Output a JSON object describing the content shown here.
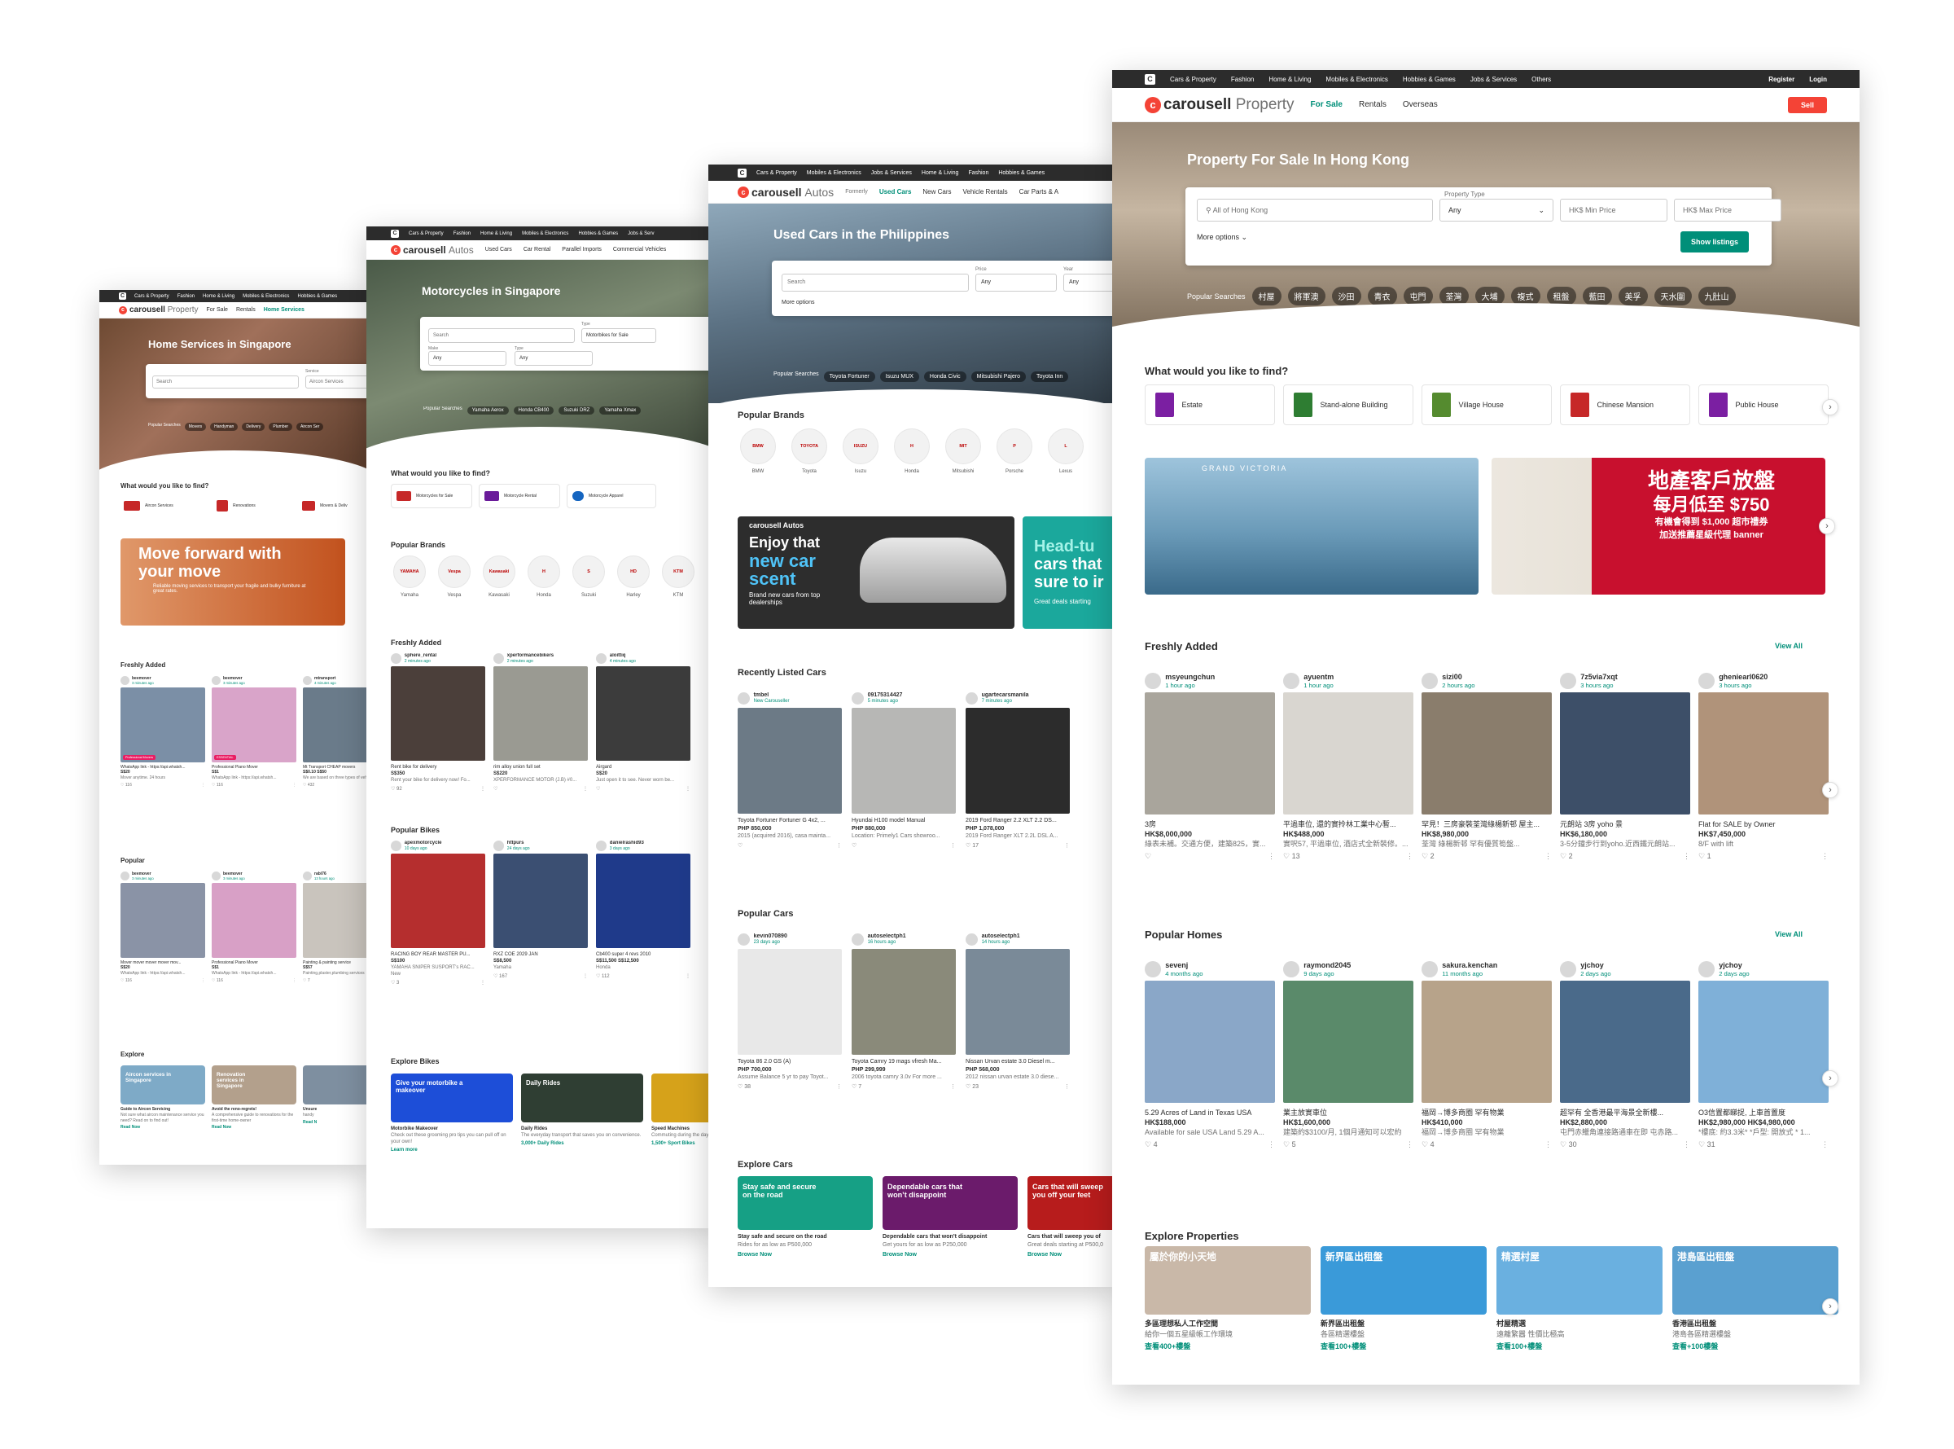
{
  "page1": {
    "topnav": [
      "Cars & Property",
      "Fashion",
      "Home & Living",
      "Mobiles & Electronics",
      "Hobbies & Games"
    ],
    "brand": "carousell",
    "brand_sub": "Property",
    "tabs": [
      "For Sale",
      "Rentals",
      "Home Services"
    ],
    "hero_title": "Home Services in Singapore",
    "search_placeholder": "Search",
    "service_label": "Service",
    "service_value": "Aircon Services",
    "popular_label": "Popular Searches",
    "popular": [
      "Movers",
      "Handyman",
      "Delivery",
      "Plumber",
      "Aircon Ser"
    ],
    "find_title": "What would you like to find?",
    "categories": [
      "Aircon Services",
      "Renovations",
      "Movers & Deliv"
    ],
    "banner_title": "Move forward with your move",
    "banner_sub": "Reliable moving services to transport your fragile and bulky furniture at great rates.",
    "fresh_title": "Freshly Added",
    "fresh": [
      {
        "user": "beemover",
        "time": "3 minutes ago",
        "badge": "Professional Movers",
        "price": "S$20",
        "desc": "WhatsApp link - https://api.whatsh...",
        "sub": "Mover anytime. 24 hours",
        "likes": "116"
      },
      {
        "user": "beemover",
        "time": "3 minutes ago",
        "badge": "ESSENTIAL",
        "price": "S$1",
        "desc": "Professional Piano Mover",
        "sub": "WhatsApp link - https://api.whatsh...",
        "likes": "116"
      },
      {
        "user": "mtransport",
        "time": "4 minutes ago",
        "badge": "",
        "price": "S$0.10 S$50",
        "desc": "Mt Transport CHEAP movers",
        "sub": "We are based on three types of vehicles",
        "likes": "432"
      }
    ],
    "popular_title": "Popular",
    "popular_items": [
      {
        "user": "beemover",
        "time": "3 minutes ago",
        "price": "S$20",
        "desc": "Mover mover mover mover mov...",
        "sub": "WhatsApp link - https://api.whatsh...",
        "likes": "116"
      },
      {
        "user": "beemover",
        "time": "3 minutes ago",
        "price": "S$1",
        "desc": "Professional Piano Mover",
        "sub": "WhatsApp link - https://api.whatsh...",
        "likes": "116"
      },
      {
        "user": "rabi76",
        "time": "13 hours ago",
        "price": "S$57",
        "desc": "Painting & painting service",
        "sub": "Painting,plaster,plumbing services",
        "likes": "7"
      }
    ],
    "explore_title": "Explore",
    "explore": [
      {
        "banner": "Aircon services in Singapore",
        "title": "Guide to Aircon Servicing",
        "desc": "Not sure what aircon maintenance service you need? Read on to find out!",
        "link": "Read Now"
      },
      {
        "banner": "Renovation services in Singapore",
        "title": "Avoid the reno-regrets!",
        "desc": "A comprehensive guide to renovations for the first-time home-owner",
        "link": "Read Now"
      },
      {
        "banner": "",
        "title": "Unsure",
        "desc": "handy",
        "link": "Read N"
      }
    ]
  },
  "page2": {
    "topnav": [
      "Cars & Property",
      "Fashion",
      "Home & Living",
      "Mobiles & Electronics",
      "Hobbies & Games",
      "Jobs & Serv"
    ],
    "brand": "carousell",
    "brand_sub": "Autos",
    "tabs": [
      "Used Cars",
      "Car Rental",
      "Parallel Imports",
      "Commercial Vehicles"
    ],
    "hero_title": "Motorcycles in Singapore",
    "search_placeholder": "Search",
    "type_label": "Type",
    "type_value": "Motorbikes for Sale",
    "make_label": "Make",
    "make_value": "Any",
    "type2_label": "Type",
    "type2_value": "Any",
    "popular_label": "Popular Searches",
    "popular": [
      "Yamaha Aerox",
      "Honda CB400",
      "Suzuki DRZ",
      "Yamaha Xmax"
    ],
    "find_title": "What would you like to find?",
    "categories": [
      "Motorcycles for Sale",
      "Motorcycle Rental",
      "Motorcycle Apparel"
    ],
    "brands_title": "Popular Brands",
    "brands": [
      {
        "logo": "YAMAHA",
        "name": "Yamaha"
      },
      {
        "logo": "Vespa",
        "name": "Vespa"
      },
      {
        "logo": "Kawasaki",
        "name": "Kawasaki"
      },
      {
        "logo": "H",
        "name": "Honda"
      },
      {
        "logo": "S",
        "name": "Suzuki"
      },
      {
        "logo": "HD",
        "name": "Harley"
      },
      {
        "logo": "KTM",
        "name": "KTM"
      }
    ],
    "fresh_title": "Freshly Added",
    "fresh": [
      {
        "user": "sphere_rental",
        "time": "2 minutes ago",
        "price": "S$350",
        "desc": "Rent bike for delivery",
        "sub": "Rent your bike for delivery now! Fo...",
        "likes": "92"
      },
      {
        "user": "xperformancebikers",
        "time": "2 minutes ago",
        "price": "S$220",
        "desc": "rim alloy union full set",
        "sub": "XPERFORMANCE MOTOR (J.B) #0...",
        "likes": ""
      },
      {
        "user": "aloittiq",
        "time": "4 minutes ago",
        "price": "S$20",
        "desc": "Airgard",
        "sub": "Just open it to see. Never worn be...",
        "likes": ""
      }
    ],
    "bikes_title": "Popular Bikes",
    "bikes": [
      {
        "user": "apexmotorcycle",
        "time": "10 days ago",
        "price": "S$100",
        "desc": "RACING BOY REAR MASTER PU...",
        "sub": "YAMAHA SNIPER SUSPORT’s RAC...",
        "cond": "New",
        "likes": "3"
      },
      {
        "user": "httpurs",
        "time": "24 days ago",
        "price": "S$8,500",
        "desc": "RXZ COE 2029 JAN",
        "sub": "Yamaha",
        "cond": "",
        "likes": "167"
      },
      {
        "user": "danielrashid93",
        "time": "3 days ago",
        "price": "S$11,500 S$12,500",
        "desc": "Cb400 super 4 revs 2010",
        "sub": "Honda",
        "cond": "",
        "likes": "112"
      }
    ],
    "explore_title": "Explore Bikes",
    "explore": [
      {
        "banner": "Give your motorbike a makeover",
        "title": "Motorbike Makeover",
        "desc": "Check out these grooming pro tips you can pull off on your own!",
        "link": "Learn more"
      },
      {
        "banner": "Daily Rides",
        "title": "Daily Rides",
        "desc": "The everyday transport that saves you on convenience.",
        "link": "3,000+ Daily Rides"
      },
      {
        "banner": "",
        "title": "Speed Machines",
        "desc": "Commuting during the days on the weekend",
        "link": "1,500+ Sport Bikes"
      }
    ]
  },
  "page3": {
    "topnav": [
      "Cars & Property",
      "Mobiles & Electronics",
      "Jobs & Services",
      "Home & Living",
      "Fashion",
      "Hobbies & Games"
    ],
    "brand": "carousell",
    "brand_sub": "Autos",
    "formerly": "Formerly",
    "tabs": [
      "Used Cars",
      "New Cars",
      "Vehicle Rentals",
      "Car Parts & A"
    ],
    "hero_title": "Used Cars in the Philippines",
    "search_placeholder": "Search",
    "price_label": "Price",
    "price_value": "Any",
    "year_label": "Year",
    "year_value": "Any",
    "more_options": "More options",
    "popular_label": "Popular Searches",
    "popular": [
      "Toyota Fortuner",
      "Isuzu MUX",
      "Honda Civic",
      "Mitsubishi Pajero",
      "Toyota Inn"
    ],
    "brands_title": "Popular Brands",
    "brands": [
      {
        "logo": "BMW",
        "name": "BMW"
      },
      {
        "logo": "TOYOTA",
        "name": "Toyota"
      },
      {
        "logo": "ISUZU",
        "name": "Isuzu"
      },
      {
        "logo": "H",
        "name": "Honda"
      },
      {
        "logo": "MIT",
        "name": "Mitsubishi"
      },
      {
        "logo": "P",
        "name": "Porsche"
      },
      {
        "logo": "L",
        "name": "Lexus"
      }
    ],
    "banner1_brand": "carousell Autos",
    "banner1_l1": "Enjoy that",
    "banner1_l2": "new car",
    "banner1_l3": "scent",
    "banner1_sub": "Brand new cars from top dealerships",
    "banner2_l1": "Head-tu",
    "banner2_l2": "cars that",
    "banner2_l3": "sure to ir",
    "banner2_sub": "Great deals starting",
    "recent_title": "Recently Listed Cars",
    "recent": [
      {
        "user": "tmbel",
        "time": "New Carouseller",
        "price": "PHP 850,000",
        "desc": "Toyota Fortuner Fortuner G 4x2, ...",
        "sub": "2015 (acquired 2016), casa mainta...",
        "likes": ""
      },
      {
        "user": "09175314427",
        "time": "5 minutes ago",
        "price": "PHP 880,000",
        "desc": "Hyundai H100 model Manual",
        "sub": "Location: Primely1 Cars showroo...",
        "likes": ""
      },
      {
        "user": "ugartecarsmanila",
        "time": "7 minutes ago",
        "price": "PHP 1,078,000",
        "desc": "2019 Ford Ranger 2.2 XLT 2.2 DS...",
        "sub": "2019 Ford Ranger XLT 2.2L DSL A...",
        "likes": "17"
      }
    ],
    "popcars_title": "Popular Cars",
    "popcars": [
      {
        "user": "kevin070890",
        "time": "23 days ago",
        "price": "PHP 700,000",
        "desc": "Toyota 86 2.0 GS (A)",
        "sub": "Assume Balance 5 yr to pay Toyot...",
        "likes": "38"
      },
      {
        "user": "autoselectph1",
        "time": "16 hours ago",
        "price": "PHP 299,999",
        "desc": "Toyota Camry 19 mags vfresh Ma...",
        "sub": "2006 toyota camry 3.0v For more ...",
        "likes": "7"
      },
      {
        "user": "autoselectph1",
        "time": "14 hours ago",
        "price": "PHP 568,000",
        "desc": "Nissan Urvan estate 3.0 Diesel m...",
        "sub": "2012 nissan urvan estate 3.0 diese...",
        "likes": "23"
      }
    ],
    "explore_title": "Explore Cars",
    "explore": [
      {
        "banner": "Stay safe and secure on the road",
        "title": "Stay safe and secure on the road",
        "desc": "Rides for as low as P500,000",
        "link": "Browse Now"
      },
      {
        "banner": "Dependable cars that won’t disappoint",
        "title": "Dependable cars that won’t disappoint",
        "desc": "Get yours for as low as P250,000",
        "link": "Browse Now"
      },
      {
        "banner": "Cars that will sweep you off your feet",
        "title": "Cars that will sweep you of",
        "desc": "Great deals starting at P500,0",
        "link": "Browse Now"
      }
    ]
  },
  "page4": {
    "topnav": [
      "Cars & Property",
      "Fashion",
      "Home & Living",
      "Mobiles & Electronics",
      "Hobbies & Games",
      "Jobs & Services",
      "Others"
    ],
    "register": "Register",
    "login": "Login",
    "brand": "carousell",
    "brand_sub": "Property",
    "tabs": [
      "For Sale",
      "Rentals",
      "Overseas"
    ],
    "sell": "Sell",
    "hero_title": "Property For Sale In Hong Kong",
    "location_placeholder": "All of Hong Kong",
    "ptype_label": "Property Type",
    "ptype_value": "Any",
    "min_price": "HK$  Min Price",
    "max_price": "HK$  Max Price",
    "more_options": "More options",
    "show_listings": "Show listings",
    "popular_label": "Popular Searches",
    "popular": [
      "村屋",
      "將軍澳",
      "沙田",
      "青衣",
      "屯門",
      "荃灣",
      "大埔",
      "複式",
      "租盤",
      "藍田",
      "美孚",
      "天水圍",
      "九肚山"
    ],
    "find_title": "What would you like to find?",
    "categories": [
      "Estate",
      "Stand-alone Building",
      "Village House",
      "Chinese Mansion",
      "Public House"
    ],
    "banner1_title": "GRAND VICTORIA",
    "banner2_l1": "地產客戶放盤",
    "banner2_l2": "每月低至 $750",
    "banner2_l3": "有機會得到 $1,000 超市禮券",
    "banner2_l4": "加送推薦星級代理 banner",
    "fresh_title": "Freshly Added",
    "view_all": "View All",
    "fresh": [
      {
        "user": "msyeungchun",
        "time": "1 hour ago",
        "title": "3房",
        "price": "HK$8,000,000",
        "desc": "綠表未補。交通方便，建築825，實...",
        "likes": ""
      },
      {
        "user": "ayuentm",
        "time": "1 hour ago",
        "title": "平過車位, 還的實拎林工業中心暫...",
        "price": "HK$488,000",
        "desc": "實呎57, 平過車位, 酒店式全新裝修。...",
        "likes": "13"
      },
      {
        "user": "sizi00",
        "time": "2 hours ago",
        "title": "罕見！三房豪裝荃灣綠楊新邨 屋主...",
        "price": "HK$8,980,000",
        "desc": "荃灣 綠楊新邨 罕有優質筍盤...",
        "likes": "2"
      },
      {
        "user": "7z5via7xqt",
        "time": "3 hours ago",
        "title": "元朗站 3房 yoho 景",
        "price": "HK$6,180,000",
        "desc": "3-5分鐘步行到yoho.近西鐵元朗站...",
        "likes": "2"
      },
      {
        "user": "gheniearl0620",
        "time": "3 hours ago",
        "title": "Flat for SALE by Owner",
        "price": "HK$7,450,000",
        "desc": "8/F with lift",
        "likes": "1"
      }
    ],
    "homes_title": "Popular Homes",
    "homes": [
      {
        "user": "sevenj",
        "time": "4 months ago",
        "title": "5.29 Acres of Land in Texas USA",
        "price": "HK$188,000",
        "desc": "Available for sale USA Land 5.29 A...",
        "likes": "4"
      },
      {
        "user": "raymond2045",
        "time": "9 days ago",
        "title": "業主放實車位",
        "price": "HK$1,600,000",
        "desc": "建築約$3100/月, 1個月通知可以宏約",
        "likes": "5"
      },
      {
        "user": "sakura.kenchan",
        "time": "11 months ago",
        "title": "福岡→博多商圈  罕有物業",
        "price": "HK$410,000",
        "desc": "福岡→博多商圈  罕有物業",
        "likes": "4"
      },
      {
        "user": "yjchoy",
        "time": "2 days ago",
        "title": "超罕有 全香港最平海景全新樓...",
        "price": "HK$2,880,000",
        "desc": "屯門赤鱲角連接路通車在即 屯赤路...",
        "likes": "30"
      },
      {
        "user": "yjchoy",
        "time": "2 days ago",
        "title": "O3信置都睇捉, 上車首置度",
        "price": "HK$2,980,000 HK$4,980,000",
        "desc": "*樓底: 約3.3米* *戶型: 開放式 * 1...",
        "likes": "31"
      }
    ],
    "explore_title": "Explore Properties",
    "explore": [
      {
        "banner": "屬於你的小天地",
        "title": "多區理想私人工作空間",
        "desc": "給你一個五星級帳工作環境",
        "link": "查看400+樓盤"
      },
      {
        "banner": "新界區出租盤",
        "title": "新界區出租盤",
        "desc": "各區精選樓盤",
        "link": "查看100+樓盤"
      },
      {
        "banner": "精選村屋",
        "title": "村屋精選",
        "desc": "遠離繁囂 性價比極高",
        "link": "查看100+樓盤"
      },
      {
        "banner": "港島區出租盤",
        "title": "香港區出租盤",
        "desc": "港島各區精選樓盤",
        "link": "查看+100樓盤"
      }
    ]
  }
}
